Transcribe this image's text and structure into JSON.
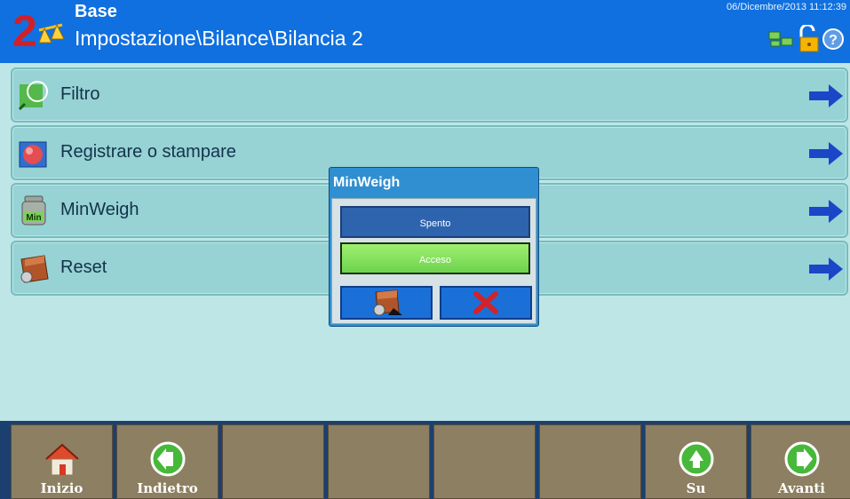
{
  "header": {
    "title": "Base",
    "path": "Impostazione\\Bilance\\Bilancia 2",
    "datetime": "06/Dicembre/2013 11:12:39",
    "scale_number": "2"
  },
  "menu": {
    "items": [
      {
        "label": "Filtro",
        "icon": "filter-icon"
      },
      {
        "label": "Registrare o stampare",
        "icon": "record-print-icon"
      },
      {
        "label": "MinWeigh",
        "icon": "minweigh-icon",
        "icon_text": "Min"
      },
      {
        "label": "Reset",
        "icon": "reset-box-icon"
      }
    ]
  },
  "dialog": {
    "title": "MinWeigh",
    "options": [
      "Spento",
      "Acceso"
    ],
    "selected": "Acceso"
  },
  "softkeys": [
    {
      "label": "Inizio",
      "icon": "home-icon"
    },
    {
      "label": "Indietro",
      "icon": "back-arrow-icon"
    },
    {
      "label": "",
      "icon": ""
    },
    {
      "label": "",
      "icon": ""
    },
    {
      "label": "",
      "icon": ""
    },
    {
      "label": "",
      "icon": ""
    },
    {
      "label": "Su",
      "icon": "up-arrow-icon"
    },
    {
      "label": "Avanti",
      "icon": "forward-arrow-icon"
    }
  ],
  "colors": {
    "header_bg": "#1070e0",
    "menu_item_bg": "#97d2d4",
    "softkey_bg": "#8d7f61",
    "selected_option": "#6dd34e"
  }
}
